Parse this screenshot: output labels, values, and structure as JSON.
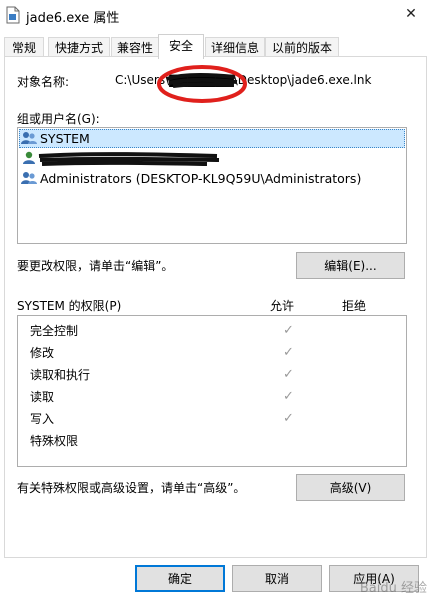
{
  "window": {
    "title": "jade6.exe 属性",
    "close_glyph": "✕"
  },
  "tabs": [
    {
      "label": "常规",
      "active": false
    },
    {
      "label": "快捷方式",
      "active": false
    },
    {
      "label": "兼容性",
      "active": false
    },
    {
      "label": "安全",
      "active": true
    },
    {
      "label": "详细信息",
      "active": false
    },
    {
      "label": "以前的版本",
      "active": false
    }
  ],
  "security": {
    "object_name_label": "对象名称:",
    "object_name_value": "C:\\Users\\▇▇▇▇▇▇▇\\Desktop\\jade6.exe.lnk",
    "group_label": "组或用户名(G):",
    "users": [
      {
        "name": "SYSTEM",
        "icon": "user-group-icon",
        "selected": true
      },
      {
        "name": "▇▇▇▇▇▇▇▇▇▇▇▇▇▇▇▇▇▇▇▇▇▇▇▇▇",
        "icon": "user-icon",
        "selected": false
      },
      {
        "name": "Administrators (DESKTOP-KL9Q59U\\Administrators)",
        "icon": "user-group-icon",
        "selected": false
      }
    ],
    "edit_hint": "要更改权限，请单击“编辑”。",
    "edit_button": "编辑(E)...",
    "perm_header": "SYSTEM 的权限(P)",
    "allow_header": "允许",
    "deny_header": "拒绝",
    "permissions": [
      {
        "name": "完全控制",
        "allow": "✓"
      },
      {
        "name": "修改",
        "allow": "✓"
      },
      {
        "name": "读取和执行",
        "allow": "✓"
      },
      {
        "name": "读取",
        "allow": "✓"
      },
      {
        "name": "写入",
        "allow": "✓"
      },
      {
        "name": "特殊权限",
        "allow": ""
      }
    ],
    "advanced_hint": "有关特殊权限或高级设置，请单击“高级”。",
    "advanced_button": "高级(V)"
  },
  "footer": {
    "ok": "确定",
    "cancel": "取消",
    "apply": "应用(A)"
  },
  "watermark": "Baidu 经验",
  "colors": {
    "selection": "#cce8ff",
    "accent_border": "#0078d7",
    "annotation_red": "#e0201c"
  }
}
